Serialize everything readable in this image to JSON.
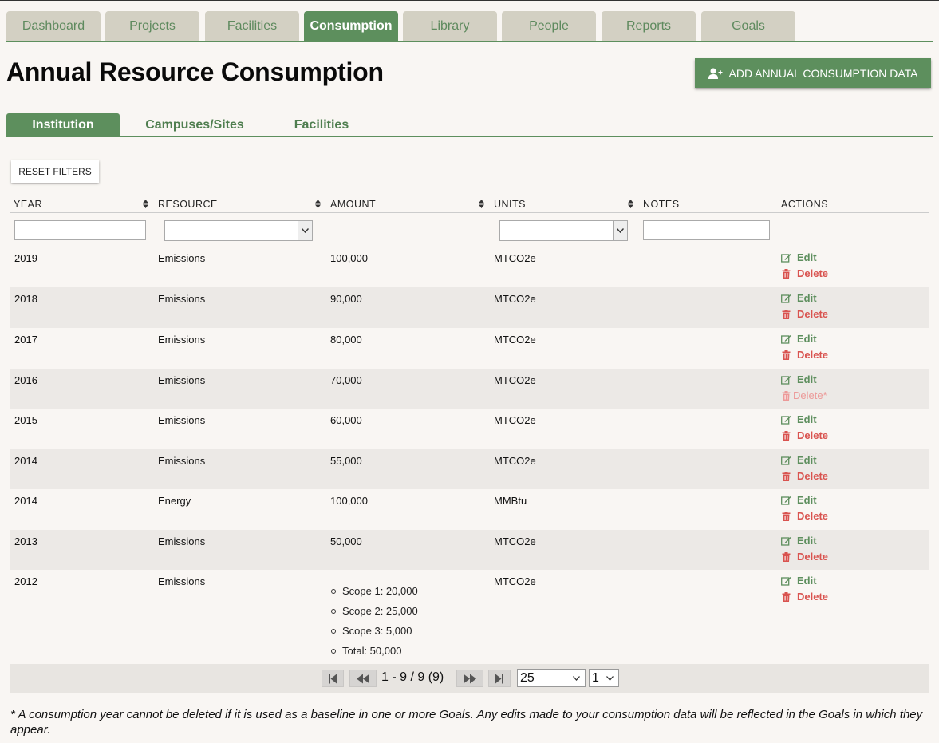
{
  "nav": {
    "tabs": [
      {
        "label": "Dashboard"
      },
      {
        "label": "Projects"
      },
      {
        "label": "Facilities"
      },
      {
        "label": "Consumption",
        "active": true
      },
      {
        "label": "Library"
      },
      {
        "label": "People"
      },
      {
        "label": "Reports"
      },
      {
        "label": "Goals"
      }
    ]
  },
  "page": {
    "title": "Annual Resource Consumption",
    "add_button": "ADD ANNUAL CONSUMPTION DATA",
    "reset_filters": "RESET FILTERS"
  },
  "subtabs": [
    {
      "label": "Institution",
      "active": true
    },
    {
      "label": "Campuses/Sites"
    },
    {
      "label": "Facilities"
    }
  ],
  "table": {
    "columns": [
      "YEAR",
      "RESOURCE",
      "AMOUNT",
      "UNITS",
      "NOTES",
      "ACTIONS"
    ],
    "actions": {
      "edit": "Edit",
      "delete": "Delete",
      "delete_disabled": "Delete*"
    },
    "rows": [
      {
        "year": "2019",
        "resource": "Emissions",
        "amount": "100,000",
        "units": "MTCO2e"
      },
      {
        "year": "2018",
        "resource": "Emissions",
        "amount": "90,000",
        "units": "MTCO2e"
      },
      {
        "year": "2017",
        "resource": "Emissions",
        "amount": "80,000",
        "units": "MTCO2e"
      },
      {
        "year": "2016",
        "resource": "Emissions",
        "amount": "70,000",
        "units": "MTCO2e"
      },
      {
        "year": "2015",
        "resource": "Emissions",
        "amount": "60,000",
        "units": "MTCO2e"
      },
      {
        "year": "2014",
        "resource": "Emissions",
        "amount": "55,000",
        "units": "MTCO2e"
      },
      {
        "year": "2014",
        "resource": "Energy",
        "amount": "100,000",
        "units": "MMBtu"
      },
      {
        "year": "2013",
        "resource": "Emissions",
        "amount": "50,000",
        "units": "MTCO2e"
      },
      {
        "year": "2012",
        "resource": "Emissions",
        "units": "MTCO2e",
        "scopes": [
          "Scope 1: 20,000",
          "Scope 2: 25,000",
          "Scope 3: 5,000",
          "Total: 50,000"
        ]
      }
    ]
  },
  "pager": {
    "info": "1 - 9 / 9 (9)",
    "page_size": "25",
    "page": "1"
  },
  "footnote": "* A consumption year cannot be deleted if it is used as a baseline in one or more Goals. Any edits made to your consumption data will be reflected in the Goals in which they appear.",
  "colors": {
    "accent": "#5d8f5d",
    "tab_inactive": "#d3d0c3",
    "delete": "#d9534f",
    "delete_disabled": "#ec9a99"
  },
  "icons": {
    "add_button": "add-user-icon",
    "edit": "edit-icon",
    "delete": "trash-icon",
    "sort": "sort-icon"
  }
}
